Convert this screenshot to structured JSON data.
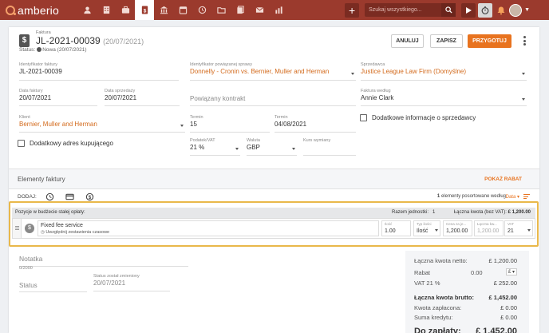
{
  "app": {
    "brand": "amberio"
  },
  "nav": {
    "icons": [
      "user-icon",
      "building-icon",
      "briefcase-icon",
      "invoice-icon",
      "bank-icon",
      "calendar-icon",
      "clock-history-icon",
      "folder-icon",
      "documents-icon",
      "mail-icon",
      "chart-icon"
    ],
    "active_index": 3,
    "search_placeholder": "Szukaj wszystkiego...",
    "plus": "+"
  },
  "header": {
    "kind": "Faktura",
    "number": "JL-2021-00039",
    "date": "(20/07/2021)",
    "status_label": "Status:",
    "status_value": "Nowa (20/07/2021)",
    "buttons": {
      "cancel": "ANULUJ",
      "save": "ZAPISZ",
      "prepare": "PRZYGOTUJ"
    }
  },
  "form": {
    "invoice_id": {
      "label": "Identyfikator faktury",
      "value": "JL-2021-00039"
    },
    "related_case": {
      "label": "Identyfikator powiązanej sprawy",
      "value": "Donnelly - Cronin vs. Bernier, Muller and Herman"
    },
    "seller": {
      "label": "Sprzedawca",
      "value": "Justice League Law Firm (Domyślne)"
    },
    "invoice_date": {
      "label": "Data faktury",
      "value": "20/07/2021"
    },
    "sale_date": {
      "label": "Data sprzedaży",
      "value": "20/07/2021"
    },
    "related_contract": {
      "placeholder": "Powiązany kontrakt"
    },
    "invoice_by": {
      "label": "Faktura według",
      "value": "Annie Clark"
    },
    "client": {
      "label": "Klient",
      "value": "Bernier, Muller and Herman"
    },
    "term": {
      "label": "Termin",
      "value": "15"
    },
    "due": {
      "label": "Termin",
      "value": "04/08/2021"
    },
    "extra_seller_info": "Dodatkowe informacje o sprzedawcy",
    "extra_buyer_address": "Dodatkowy adres kupującego",
    "tax": {
      "label": "Podatek/VAT",
      "value": "21 %"
    },
    "currency": {
      "label": "Waluta",
      "value": "GBP"
    },
    "exchange_rate": {
      "label": "Kurs wymiany"
    }
  },
  "items_section": {
    "title": "Elementy faktury",
    "show_discount": "POKAŻ RABAT",
    "add_label": "DODAJ:",
    "sort_count": "1",
    "sort_text": "elementy posortowane według",
    "sort_field": "Data ▾"
  },
  "group": {
    "title": "Pozycje w budżecie stałej opłaty:",
    "total_units_label": "Razem jednostki:",
    "total_units": "1",
    "total_amount_label": "Łączna kwota (bez VAT):",
    "total_amount": "£ 1,200.00"
  },
  "item": {
    "icon": "$",
    "name": "Fixed fee service",
    "subline": "Uwzględnij zestawienia czasowe",
    "qty": {
      "label": "Ilość",
      "value": "1.00"
    },
    "unit_type": {
      "label": "Typ ilości",
      "value": "Ilość"
    },
    "unit_price": {
      "label": "Cena za je...",
      "value": "1,200.00"
    },
    "total": {
      "label": "Łączna kw...",
      "value": "1,200.00"
    },
    "vat": {
      "label": "VAT",
      "value": "21"
    }
  },
  "notes": {
    "label": "Notatka",
    "counter": "0/2000",
    "status_label": "Status",
    "status_changed_label": "Status został zmieniony",
    "status_changed_value": "20/07/2021"
  },
  "totals": {
    "net_label": "Łączna kwota netto:",
    "net_value": "£ 1,200.00",
    "discount_label": "Rabat",
    "discount_value": "0.00",
    "discount_unit": "£",
    "vat_label": "VAT 21 %",
    "vat_value": "£ 252.00",
    "gross_label": "Łączna kwota brutto:",
    "gross_value": "£ 1,452.00",
    "paid_label": "Kwota zapłacona:",
    "paid_value": "£ 0.00",
    "credits_label": "Suma kredytu:",
    "credits_value": "£ 0.00",
    "due_label": "Do zapłaty:",
    "due_value": "£ 1,452.00"
  }
}
